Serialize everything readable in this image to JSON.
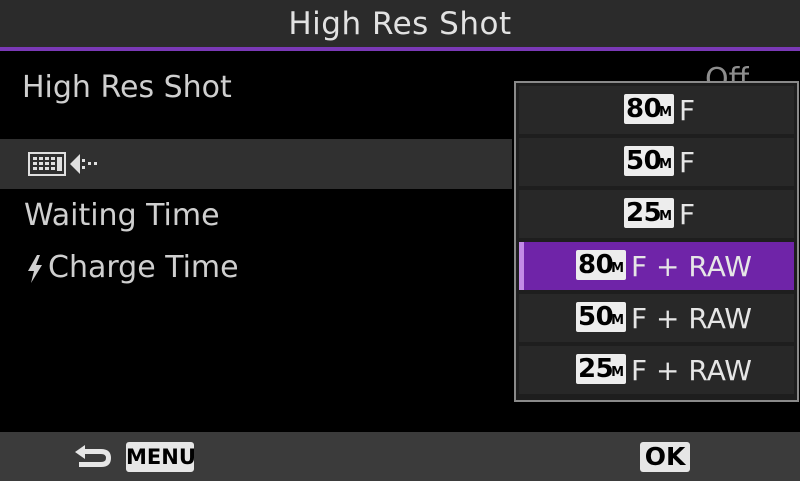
{
  "header": {
    "title": "High Res Shot"
  },
  "menu": {
    "items": [
      {
        "label": "High Res Shot",
        "value": "Off"
      },
      {
        "label": ""
      },
      {
        "label": "Waiting Time"
      },
      {
        "label": "Charge Time"
      }
    ]
  },
  "popup": {
    "options": [
      {
        "size": "80",
        "unit": "M",
        "quality": "F"
      },
      {
        "size": "50",
        "unit": "M",
        "quality": "F"
      },
      {
        "size": "25",
        "unit": "M",
        "quality": "F"
      },
      {
        "size": "80",
        "unit": "M",
        "quality": "F + RAW"
      },
      {
        "size": "50",
        "unit": "M",
        "quality": "F + RAW"
      },
      {
        "size": "25",
        "unit": "M",
        "quality": "F + RAW"
      }
    ],
    "selected_index": 3
  },
  "footer": {
    "menu_label": "MENU",
    "ok_label": "OK"
  },
  "icons": [
    "back-arrow-icon",
    "flash-icon",
    "high-res-mode-icon"
  ],
  "colors": {
    "accent": "#7a39b6",
    "selected": "#6f24a8",
    "selected_marker": "#c38be6"
  }
}
